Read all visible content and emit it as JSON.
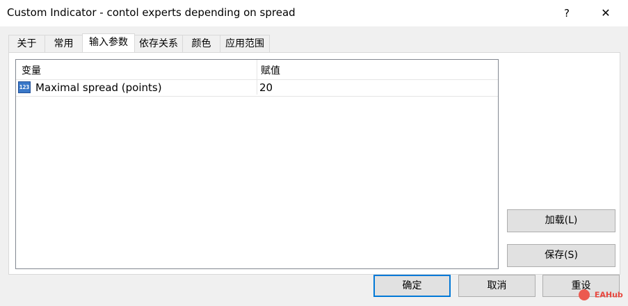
{
  "window": {
    "title": "Custom Indicator - contol experts depending on spread",
    "help_label": "?",
    "close_label": "✕"
  },
  "tabs": [
    {
      "label": "关于",
      "active": false
    },
    {
      "label": "常用",
      "active": false
    },
    {
      "label": "输入参数",
      "active": true
    },
    {
      "label": "依存关系",
      "active": false
    },
    {
      "label": "颜色",
      "active": false
    },
    {
      "label": "应用范围",
      "active": false
    }
  ],
  "params_table": {
    "columns": [
      "变量",
      "赋值"
    ],
    "rows": [
      {
        "icon": "numeric-param-icon",
        "icon_text": "123",
        "name": "Maximal spread (points)",
        "value": "20"
      }
    ]
  },
  "side_buttons": {
    "load_label": "加载(L)",
    "save_label": "保存(S)"
  },
  "footer_buttons": {
    "ok_label": "确定",
    "cancel_label": "取消",
    "reset_label": "重设"
  },
  "watermark": {
    "text": "EAHub"
  },
  "colors": {
    "accent": "#0078d7",
    "watermark": "#e8473f"
  }
}
